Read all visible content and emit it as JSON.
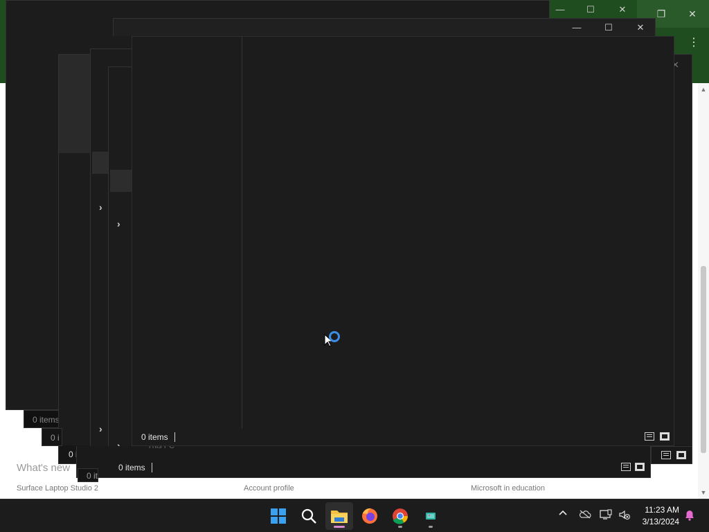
{
  "background_page": {
    "heading": "What's new",
    "links": [
      "Surface Laptop Studio 2",
      "Account profile",
      "Microsoft in education"
    ]
  },
  "explorer": {
    "status_items": "0 items",
    "nav_item": "This PC",
    "loading": true
  },
  "window_controls": {
    "minimize": "—",
    "maximize": "☐",
    "close": "✕"
  },
  "taskbar": {
    "apps": [
      {
        "name": "Start",
        "icon": "windows-start-icon"
      },
      {
        "name": "Search",
        "icon": "search-icon"
      },
      {
        "name": "File Explorer",
        "icon": "folder-icon",
        "active": true
      },
      {
        "name": "Firefox",
        "icon": "firefox-icon"
      },
      {
        "name": "Google Chrome",
        "icon": "chrome-icon"
      },
      {
        "name": "Desktop app",
        "icon": "app-icon"
      }
    ],
    "tray": {
      "chevron": "^",
      "time": "11:23 AM",
      "date": "3/13/2024"
    }
  },
  "colors": {
    "taskbar": "#1c1c1c",
    "explorer_bg": "#1c1c1c",
    "accent": "#3a8ee6",
    "browser_header": "#1f4d1f"
  }
}
